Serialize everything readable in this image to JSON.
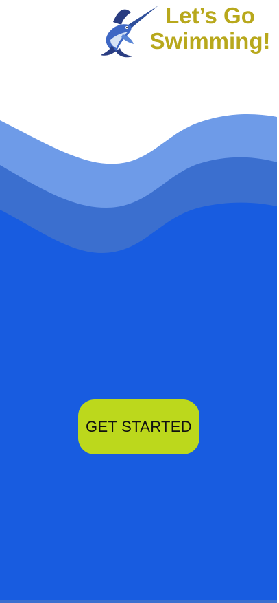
{
  "header": {
    "title_line1": "Let’s Go",
    "title_line2": "Swimming!"
  },
  "cta": {
    "label": "GET STARTED"
  },
  "colors": {
    "background": "#ffffff",
    "wave_light": "#6e9be8",
    "wave_mid": "#3b6fcf",
    "wave_deep": "#185ce0",
    "title": "#b8a81c",
    "button": "#bcd81c"
  },
  "icons": {
    "logo": "swordfish-logo"
  }
}
